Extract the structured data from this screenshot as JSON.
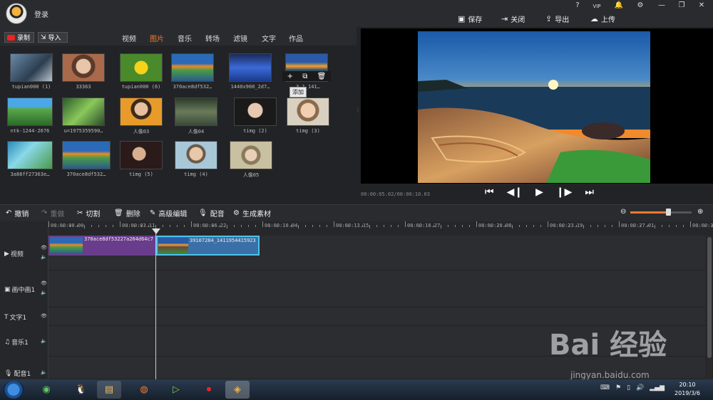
{
  "app": {
    "login": "登录"
  },
  "window_buttons": [
    "?",
    "VIP",
    "🔔",
    "⚙",
    "—",
    "❐",
    "✕"
  ],
  "actions": [
    {
      "icon": "save-icon",
      "label": "保存"
    },
    {
      "icon": "close-icon",
      "label": "关闭"
    },
    {
      "icon": "export-icon",
      "label": "导出"
    },
    {
      "icon": "upload-icon",
      "label": "上传"
    }
  ],
  "record_label": "录制",
  "import_label": "导入",
  "categories": [
    "视频",
    "图片",
    "音乐",
    "转场",
    "滤镜",
    "文字",
    "作品"
  ],
  "active_category": "图片",
  "library": [
    {
      "label": "tupian000 (1)"
    },
    {
      "label": "33363"
    },
    {
      "label": "tupian000 (6)"
    },
    {
      "label": "370ace8df532…"
    },
    {
      "label": "1440x900_2d7…"
    },
    {
      "label": "3…1_141…"
    },
    {
      "label": "ntk-1244-2676"
    },
    {
      "label": "u=1975359590…"
    },
    {
      "label": "人像03"
    },
    {
      "label": "人像04"
    },
    {
      "label": "timg (2)"
    },
    {
      "label": "timg (3)"
    },
    {
      "label": "3a88ff27363e…"
    },
    {
      "label": "370ace8df532…"
    },
    {
      "label": "timg (5)"
    },
    {
      "label": "timg (4)"
    },
    {
      "label": "人像05"
    }
  ],
  "hover_tooltip": "添加",
  "preview": {
    "time": "00:00:05.02/00:00:10.03"
  },
  "edit_toolbar": [
    {
      "icon": "undo-icon",
      "label": "撤销",
      "enabled": true
    },
    {
      "icon": "redo-icon",
      "label": "重做",
      "enabled": false
    },
    {
      "icon": "cut-icon",
      "label": "切割",
      "enabled": true
    },
    {
      "icon": "delete-icon",
      "label": "删除",
      "enabled": true
    },
    {
      "icon": "advanced-edit-icon",
      "label": "高级编辑",
      "enabled": true
    },
    {
      "icon": "mic-icon",
      "label": "配音",
      "enabled": true
    },
    {
      "icon": "generate-icon",
      "label": "生成素材",
      "enabled": true
    }
  ],
  "zoom_level": 0.6,
  "ruler": [
    "00:00:00.00",
    "00:00:03.11",
    "00:00:06.22",
    "00:00:10.04",
    "00:00:13.15",
    "00:00:16.27",
    "00:00:20.08",
    "00:00:23.19",
    "00:00:27.01",
    "00:00:30"
  ],
  "tracks": [
    {
      "label": "视频",
      "icon": "video-track-icon"
    },
    {
      "label": "画中画1",
      "icon": "pip-track-icon"
    },
    {
      "label": "文字1",
      "icon": "text-track-icon"
    },
    {
      "label": "音乐1",
      "icon": "music-track-icon"
    },
    {
      "label": "配音1",
      "icon": "voice-track-icon"
    }
  ],
  "clips": [
    "370ace8df53227a204d64c7",
    "39107284_1411954415923"
  ],
  "clock": {
    "time": "20:10",
    "date": "2019/3/6"
  },
  "watermark": {
    "brand": "Bai 经验",
    "url": "jingyan.baidu.com"
  }
}
